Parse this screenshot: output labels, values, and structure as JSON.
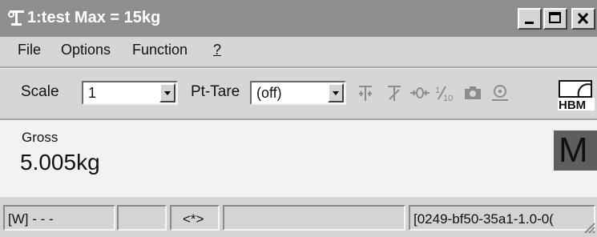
{
  "window": {
    "title": "1:test Max = 15kg"
  },
  "menu": {
    "file": "File",
    "options": "Options",
    "function": "Function",
    "help": "?"
  },
  "toolbar": {
    "scale_label": "Scale",
    "scale_value": "1",
    "pt_tare_label": "Pt-Tare",
    "pt_tare_value": "(off)",
    "tools": [
      "tare-icon",
      "zero-set-icon",
      "zero-icon",
      "tenth-resolution-icon",
      "camera-icon",
      "sensor-icon"
    ],
    "logo_text": "HBM"
  },
  "display": {
    "mode_label": "Gross",
    "reading": "5.005kg",
    "indicator": "M"
  },
  "status": {
    "mode": "[W] - - -",
    "flag": "<*>",
    "info": "[0249-bf50-35a1-1.0-0("
  },
  "colors": {
    "titlebar": "#8e8e8e",
    "face": "#d6d6d6",
    "display_bg": "#f2f2f2",
    "indicator_bg": "#5e5e5e"
  }
}
